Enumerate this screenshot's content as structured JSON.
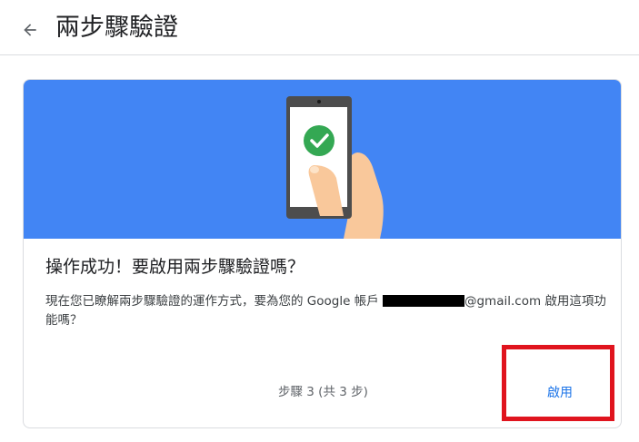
{
  "header": {
    "back_icon": "arrow-left-icon",
    "title": "兩步驟驗證"
  },
  "card": {
    "hero_icon": "phone-checkmark-illustration",
    "title": "操作成功！要啟用兩步驟驗證嗎？",
    "desc_before": "現在您已瞭解兩步驟驗證的運作方式，要為您的 Google 帳戶 ",
    "desc_after": "@gmail.com 啟用這項功能嗎？",
    "step_text": "步驟 3 (共 3 步)",
    "enable_label": "啟用"
  },
  "colors": {
    "hero_bg": "#4285f4",
    "accent": "#1a73e8",
    "check_green": "#34a853",
    "highlight": "#e0141e"
  }
}
